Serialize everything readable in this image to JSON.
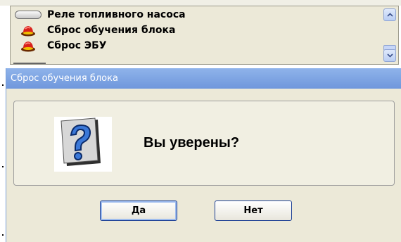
{
  "list": {
    "items": [
      {
        "label": "Реле топливного насоса",
        "icon": "toggle-pill-icon"
      },
      {
        "label": "Сброс обучения блока",
        "icon": "red-cap-icon"
      },
      {
        "label": "Сброс ЭБУ",
        "icon": "red-cap-icon"
      }
    ]
  },
  "dialog": {
    "title": "Сброс обучения блока",
    "message": "Вы уверены?",
    "icon": "question-mark-icon",
    "yes_label": "Да",
    "no_label": "Нет"
  },
  "colors": {
    "titlebar": "#7fa5e3",
    "dialog_bg": "#ece9d8",
    "button_border": "#1c3f94"
  }
}
